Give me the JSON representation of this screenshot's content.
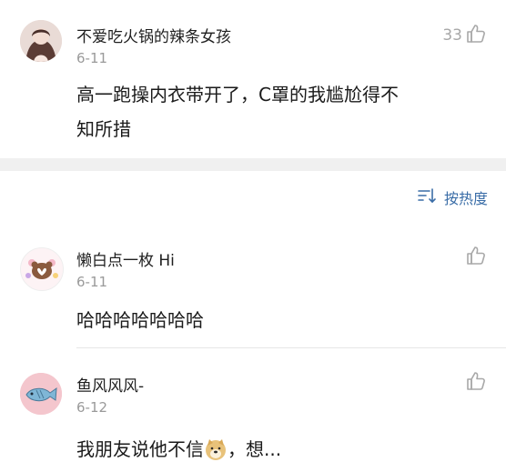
{
  "comments_top": [
    {
      "username": "不爱吃火锅的辣条女孩",
      "date": "6-11",
      "likes": "33",
      "text_line1": "高一跑操内衣带开了，C罩的我尴尬得不",
      "text_line2": "知所措"
    }
  ],
  "sort": {
    "label": "按热度"
  },
  "comments": [
    {
      "username": "懒白点一枚 Hi",
      "date": "6-11",
      "text": "哈哈哈哈哈哈哈"
    },
    {
      "username": "鱼风风风-",
      "date": "6-12",
      "text_before": "我朋友说他不信",
      "text_after": "，想..."
    }
  ],
  "icons": {
    "like": "thumbs-up-icon",
    "sort": "sort-icon",
    "emoji": "doge-emoji-icon"
  },
  "colors": {
    "link_blue": "#3a6da7",
    "meta_gray": "#9a9a9a"
  }
}
